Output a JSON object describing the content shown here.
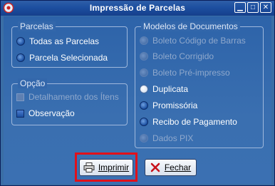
{
  "window": {
    "title": "Impressão de Parcelas"
  },
  "parcelas": {
    "title": "Parcelas",
    "options": [
      {
        "label": "Todas as Parcelas",
        "selected": false
      },
      {
        "label": "Parcela Selecionada",
        "selected": true
      }
    ]
  },
  "opcao": {
    "title": "Opção",
    "items": [
      {
        "label": "Detalhamento dos Ítens",
        "checked": false,
        "enabled": false
      },
      {
        "label": "Observação",
        "checked": true,
        "enabled": true
      }
    ]
  },
  "modelos": {
    "title": "Modelos de Documentos",
    "options": [
      {
        "label": "Boleto Código de Barras",
        "enabled": false
      },
      {
        "label": "Boleto Corrigido",
        "enabled": false
      },
      {
        "label": "Boleto Pré-impresso",
        "enabled": false
      },
      {
        "label": "Duplicata",
        "enabled": true,
        "selected": false
      },
      {
        "label": "Promissória",
        "enabled": true,
        "selected": true
      },
      {
        "label": "Recibo de Pagamento",
        "enabled": true,
        "selected": true
      },
      {
        "label": "Dados PIX",
        "enabled": false
      }
    ]
  },
  "buttons": {
    "print": "Imprimir",
    "close": "Fechar"
  },
  "colors": {
    "highlight": "#e2101a",
    "accent": "#1a4ea0"
  }
}
